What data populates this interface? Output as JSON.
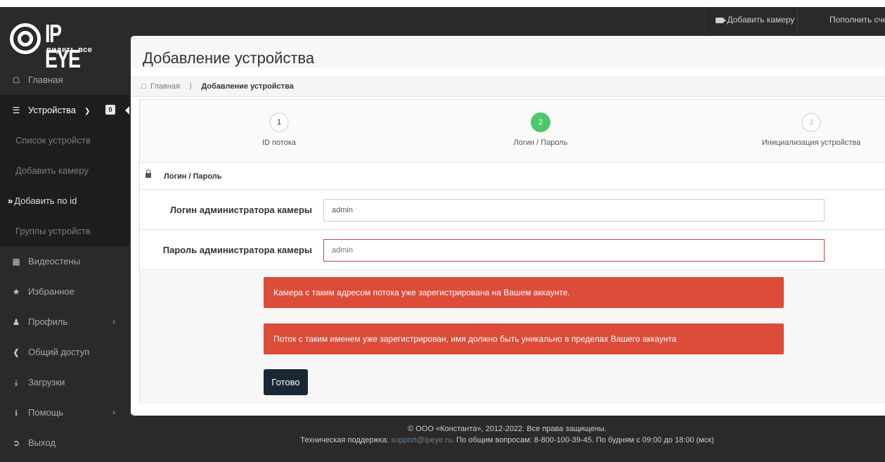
{
  "topbar": {
    "add_camera": "Добавить камеру",
    "top_up": "Пополнить счет"
  },
  "logo": {
    "brand": "IP EYE",
    "slogan": "видеть все"
  },
  "sidebar": {
    "items": [
      {
        "icon": "home-icon",
        "label": "Главная"
      },
      {
        "icon": "list-icon",
        "label": "Устройства",
        "badge": "0"
      },
      {
        "label": "Список устройств"
      },
      {
        "label": "Добавить камеру"
      },
      {
        "label": "Добавить по id"
      },
      {
        "label": "Группы устройств"
      },
      {
        "icon": "grid-icon",
        "label": "Видеостены"
      },
      {
        "icon": "star-icon",
        "label": "Избранное"
      },
      {
        "icon": "user-icon",
        "label": "Профиль"
      },
      {
        "icon": "share-icon",
        "label": "Общий доступ"
      },
      {
        "icon": "download-icon",
        "label": "Загрузки"
      },
      {
        "icon": "info-icon",
        "label": "Помощь"
      },
      {
        "icon": "logout-icon",
        "label": "Выход"
      }
    ]
  },
  "page": {
    "title": "Добавление устройства",
    "breadcrumb_home": "Главная",
    "breadcrumb_current": "Добавление устройства"
  },
  "steps": [
    {
      "num": "1",
      "label": "ID потока",
      "state": "done"
    },
    {
      "num": "2",
      "label": "Логин / Пароль",
      "state": "active"
    },
    {
      "num": "3",
      "label": "Инициализация устройства",
      "state": "todo"
    }
  ],
  "form": {
    "section_title": "Логин / Пароль",
    "login_label": "Логин администратора камеры",
    "login_value": "admin",
    "password_label": "Пароль администратора камеры",
    "password_placeholder": "admin",
    "submit": "Готово"
  },
  "alerts": [
    "Камера с таким адресом потока уже зарегистрирована на Вашем аккаунте.",
    "Поток с таким именем уже зарегистрирован, имя должно быть уникально в пределах Вашего аккаунта"
  ],
  "footer": {
    "copyright": "© ООО «Константа», 2012-2022. Все права защищены.",
    "support_prefix": "Техническая поддержка:",
    "support_email": "support@ipeye.ru",
    "support_suffix": ". По общим вопросам: 8-800-100-39-45. По будням с 09:00 до 18:00 (мск)"
  },
  "colors": {
    "sidebar_bg": "#2a2a2a",
    "alert_bg": "#dd4b39",
    "step_active": "#4cc76b",
    "button_bg": "#192734"
  }
}
